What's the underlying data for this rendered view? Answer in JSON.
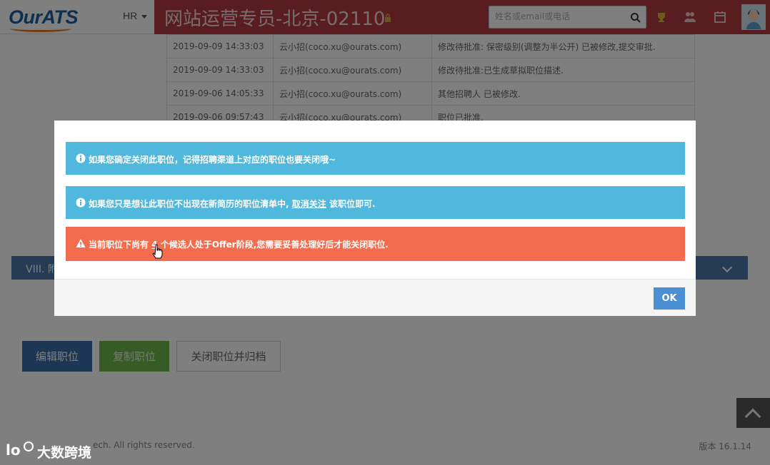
{
  "header": {
    "logo": "OurATS",
    "role_menu": "HR",
    "job_title": "网站运营专员-北京-02110",
    "search_placeholder": "姓名或email或电话"
  },
  "activity_log": [
    {
      "time": "2019-09-09 14:33:03",
      "user": "云小招(coco.xu@ourats.com)",
      "action": "修改待批准: 保密级别(调整为半公开) 已被修改,提交审批."
    },
    {
      "time": "2019-09-09 14:33:03",
      "user": "云小招(coco.xu@ourats.com)",
      "action": "修改待批准:已生成草拟职位描述."
    },
    {
      "time": "2019-09-06 14:05:33",
      "user": "云小招(coco.xu@ourats.com)",
      "action": "其他招聘人 已被修改."
    },
    {
      "time": "2019-09-06 09:57:43",
      "user": "云小招(coco.xu@ourats.com)",
      "action": "职位已批准."
    }
  ],
  "section": {
    "label": "VIII. 附"
  },
  "actions": {
    "edit": "编辑职位",
    "copy": "复制职位",
    "close_archive": "关闭职位并归档"
  },
  "footer": {
    "copyright": "ech. All rights reserved.",
    "version": "版本 16.1.14"
  },
  "modal": {
    "alert1": "如果您确定关闭此职位，记得招聘渠道上对应的职位也要关闭哦~",
    "alert2_prefix": "如果您只是想让此职位不出现在新简历的职位清单中,",
    "alert2_link": "取消关注",
    "alert2_suffix": "该职位即可.",
    "alert3_prefix": "当前职位下尚有",
    "alert3_count": "4",
    "alert3_suffix": "个候选人处于Offer阶段,您需要妥善处理好后才能关闭职位.",
    "ok": "OK"
  },
  "watermark": "大数跨境",
  "colors": {
    "title_bar": "#b33a3f",
    "info_alert": "#4fb8dc",
    "warning_alert": "#f46c4e",
    "primary_button": "#4a8fd4"
  }
}
